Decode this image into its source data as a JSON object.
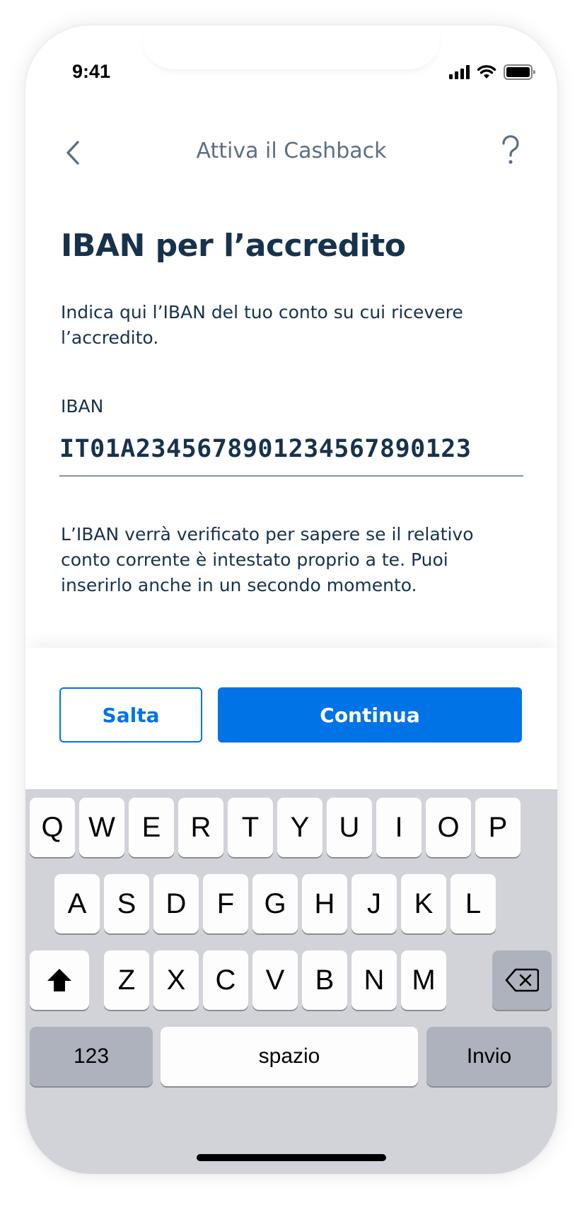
{
  "status_bar": {
    "time": "9:41"
  },
  "nav": {
    "title": "Attiva il Cashback"
  },
  "page": {
    "title": "IBAN per l’accredito",
    "intro": "Indica qui l’IBAN del tuo conto su cui ricevere l’accredito.",
    "iban_label": "IBAN",
    "iban_value": "IT01A234567890123456789012З",
    "note": "L’IBAN verrà verificato per sapere se il relativo conto corrente è intestato proprio a te. Puoi inserirlo anche in un secondo momento."
  },
  "buttons": {
    "skip": "Salta",
    "continue": "Continua"
  },
  "keyboard": {
    "row1": [
      "Q",
      "W",
      "E",
      "R",
      "T",
      "Y",
      "U",
      "I",
      "O",
      "P"
    ],
    "row2": [
      "A",
      "S",
      "D",
      "F",
      "G",
      "H",
      "J",
      "K",
      "L"
    ],
    "row3": [
      "Z",
      "X",
      "C",
      "V",
      "B",
      "N",
      "M"
    ],
    "numbers": "123",
    "space": "spazio",
    "return": "Invio"
  },
  "colors": {
    "primary": "#0073e6",
    "text_dark": "#17324d",
    "text_muted": "#5c6f82",
    "keyboard_bg": "#d1d3d9"
  },
  "icons": {
    "back": "chevron-left-icon",
    "help": "help-icon",
    "shift": "shift-icon",
    "delete": "backspace-icon"
  }
}
